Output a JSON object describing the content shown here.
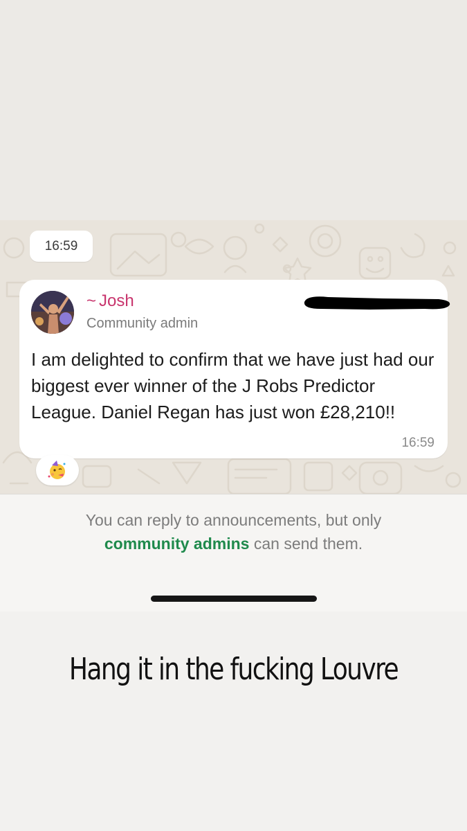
{
  "chat": {
    "date_time_pill": "16:59",
    "message": {
      "sender_name": "Josh",
      "sender_prefix": "~",
      "sender_role": "Community admin",
      "text": "I am delighted to confirm that we have just had our biggest ever winner of the J Robs Predictor League. Daniel Regan has just won £28,210!!",
      "time": "16:59",
      "reaction_emoji": "🥳"
    }
  },
  "info": {
    "line1": "You can reply to announcements, but only",
    "link": "community admins",
    "line2_suffix": " can send them."
  },
  "caption": "Hang it in the fucking Louvre",
  "colors": {
    "sender_name": "#c8356d",
    "link_green": "#1f8a4c",
    "wallpaper": "#e9e4dc"
  }
}
